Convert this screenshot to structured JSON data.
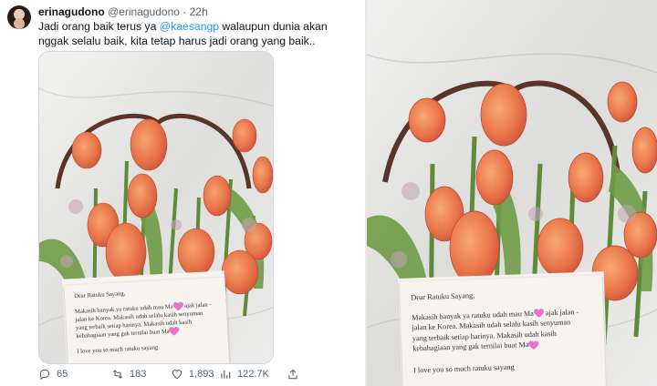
{
  "tweet": {
    "display_name": "erinagudono",
    "handle": "@erinagudono",
    "separator": "·",
    "time": "22h",
    "text_before": "Jadi orang baik terus ya ",
    "mention": "@kaesangp",
    "text_after": " walaupun dunia akan nggak selalu baik, kita tetap harus jadi orang yang baik.."
  },
  "card": {
    "greeting": "Dear Ratuku Sayang,",
    "line1a": "Makasih banyak ya ratuku udah mau Ma",
    "line1b": " ajak jalan -",
    "line2": "jalan ke Korea. Makasih udah selalu kasih senyuman",
    "line3": "yang terbaik setiap harinya. Makasih udah kasih",
    "line4a": "kebahagiaan yang gak ternilai buat Ma",
    "closing": "I love you so much ratuku sayang"
  },
  "actions": {
    "replies": "65",
    "retweets": "183",
    "likes": "1,893",
    "views": "122.7K"
  },
  "icons": {
    "reply": "reply-icon",
    "retweet": "retweet-icon",
    "like": "heart-icon",
    "views": "views-icon",
    "share": "share-icon"
  }
}
